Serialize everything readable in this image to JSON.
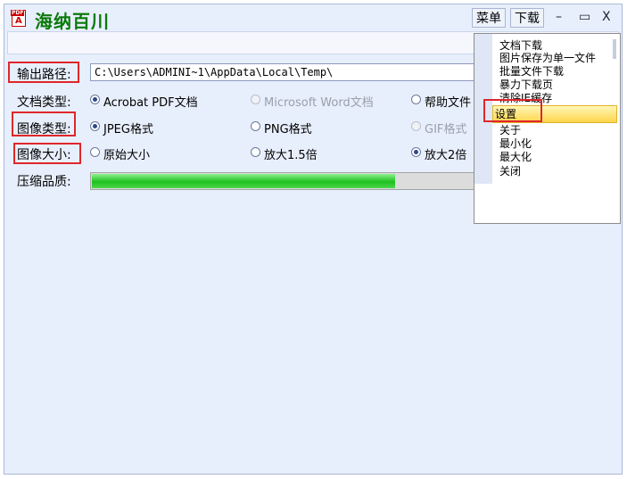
{
  "app": {
    "title": "海纳百川",
    "icon_name": "pdf-app-icon",
    "icon_badge": "PDF",
    "icon_mark": "A"
  },
  "menubar": {
    "menu_label": "菜单",
    "download_label": "下载"
  },
  "window_controls": {
    "minimize": "–",
    "maximize": "▭",
    "close": "X"
  },
  "form": {
    "output_path": {
      "label": "输出路径:",
      "value": "C:\\Users\\ADMINI~1\\AppData\\Local\\Temp\\"
    },
    "doc_type": {
      "label": "文档类型:",
      "options": [
        {
          "label": "Acrobat PDF文档",
          "checked": true,
          "disabled": false
        },
        {
          "label": "Microsoft Word文档",
          "checked": false,
          "disabled": true
        },
        {
          "label": "帮助文件",
          "checked": false,
          "disabled": false
        }
      ]
    },
    "image_type": {
      "label": "图像类型:",
      "options": [
        {
          "label": "JPEG格式",
          "checked": true,
          "disabled": false
        },
        {
          "label": "PNG格式",
          "checked": false,
          "disabled": false
        },
        {
          "label": "GIF格式",
          "checked": false,
          "disabled": true
        }
      ]
    },
    "image_size": {
      "label": "图像大小:",
      "options": [
        {
          "label": "原始大小",
          "checked": false,
          "disabled": false
        },
        {
          "label": "放大1.5倍",
          "checked": false,
          "disabled": false
        },
        {
          "label": "放大2倍",
          "checked": true,
          "disabled": false
        }
      ]
    },
    "quality": {
      "label": "压缩品质:",
      "progress_fraction": 0.78
    }
  },
  "dropdown": {
    "items": [
      {
        "label": "文档下载",
        "selected": false
      },
      {
        "label": "图片保存为单一文件",
        "selected": false
      },
      {
        "label": "批量文件下载",
        "selected": false
      },
      {
        "label": "暴力下载页",
        "selected": false
      },
      {
        "label": "清除IE缓存",
        "selected": false
      },
      {
        "label": "设置",
        "selected": true
      },
      {
        "label": "关于",
        "selected": false
      },
      {
        "label": "最小化",
        "selected": false
      },
      {
        "label": "最大化",
        "selected": false
      },
      {
        "label": "关闭",
        "selected": false
      }
    ]
  },
  "colors": {
    "highlight": "#e0262a",
    "title": "#0a7a0a",
    "progress": "#1fc11f"
  }
}
